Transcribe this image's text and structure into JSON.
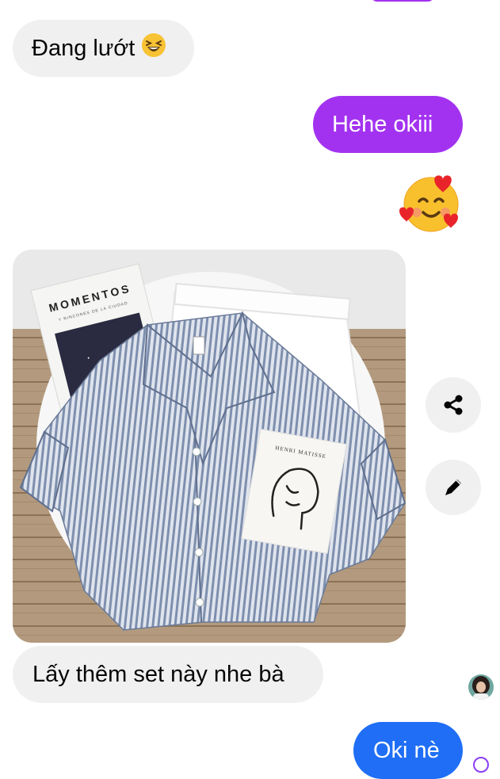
{
  "theme": {
    "outgoing_color": "#a332f0",
    "outgoing_color_bottom": "#1f6ef5",
    "incoming_color": "#f0f0f0"
  },
  "messages": [
    {
      "sender": "other",
      "text": "Đang lướt",
      "emoji": "😆"
    },
    {
      "sender": "me",
      "text": "Hehe okiii"
    },
    {
      "sender": "me",
      "emoji": "🥰"
    },
    {
      "sender": "other",
      "type": "photo",
      "book_title": "MOMENTOS",
      "book_subtitle": "Y RINCONES DE LA CIUDAD",
      "card_title": "HENRI MATISSE"
    },
    {
      "sender": "other",
      "text": "Lấy thêm set này nhe bà"
    },
    {
      "sender": "me",
      "text": "Oki nè"
    }
  ],
  "actions": {
    "share_icon": "share-icon",
    "edit_icon": "pencil-icon"
  }
}
